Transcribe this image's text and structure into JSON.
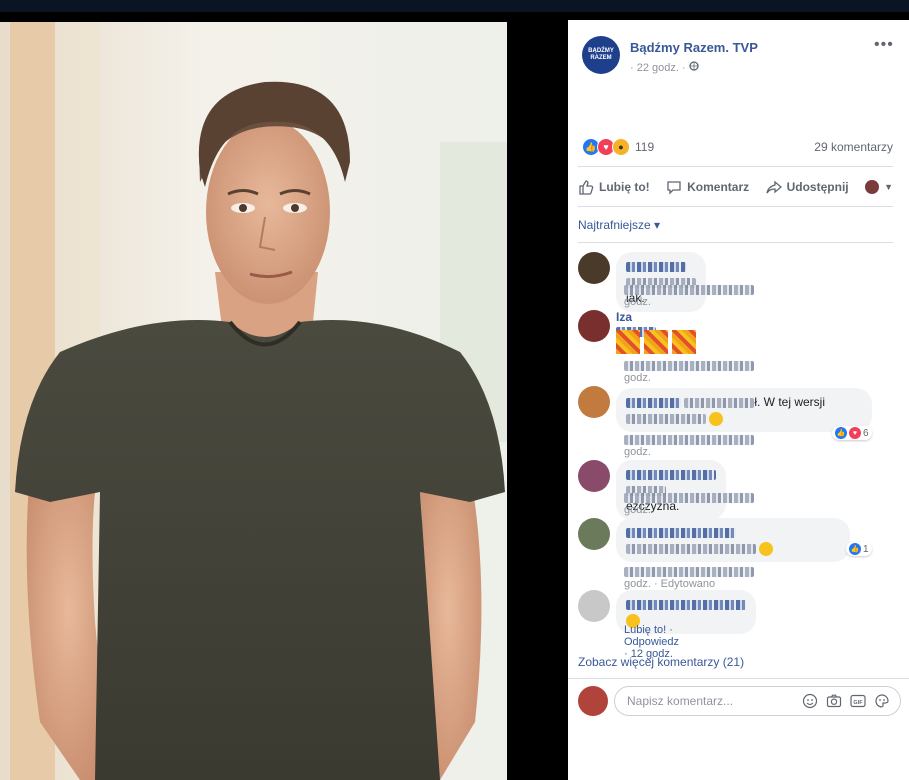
{
  "post": {
    "page_name": "Bądźmy Razem. TVP",
    "page_avatar_text": "BĄDŹMY RAZEM",
    "time": "· 22 godz. ·",
    "reaction_count": "119",
    "comments_count": "29 komentarzy"
  },
  "actions": {
    "like": "Lubię to!",
    "comment": "Komentarz",
    "share": "Udostępnij"
  },
  "sort_label": "Najtrafniejsze ▾",
  "comments": [
    {
      "text_visible": "iak.",
      "meta_suffix": "godz."
    },
    {
      "name_visible": "Iza",
      "meta_suffix": "godz."
    },
    {
      "text_visible_1": "ł. W tej wersji",
      "meta_suffix": "godz.",
      "reactions": "6"
    },
    {
      "text_visible": "eżczyzna.",
      "meta_suffix": "godz."
    },
    {
      "meta_suffix": "godz. · Edytowano",
      "reactions": "1"
    },
    {
      "meta": "Lubię to! · Odpowiedz · 12 godz."
    }
  ],
  "more_comments": "Zobacz więcej komentarzy (21)",
  "compose": {
    "placeholder": "Napisz komentarz..."
  },
  "colors": {
    "link": "#385898",
    "panel_bg": "#ffffff",
    "bubble_bg": "#f2f3f5",
    "like_blue": "#2078f4",
    "love_red": "#f33e58"
  },
  "icons": [
    "more-icon",
    "globe-icon",
    "like-icon",
    "comment-icon",
    "share-icon",
    "emoji-icon",
    "camera-icon",
    "gif-icon",
    "sticker-icon"
  ]
}
